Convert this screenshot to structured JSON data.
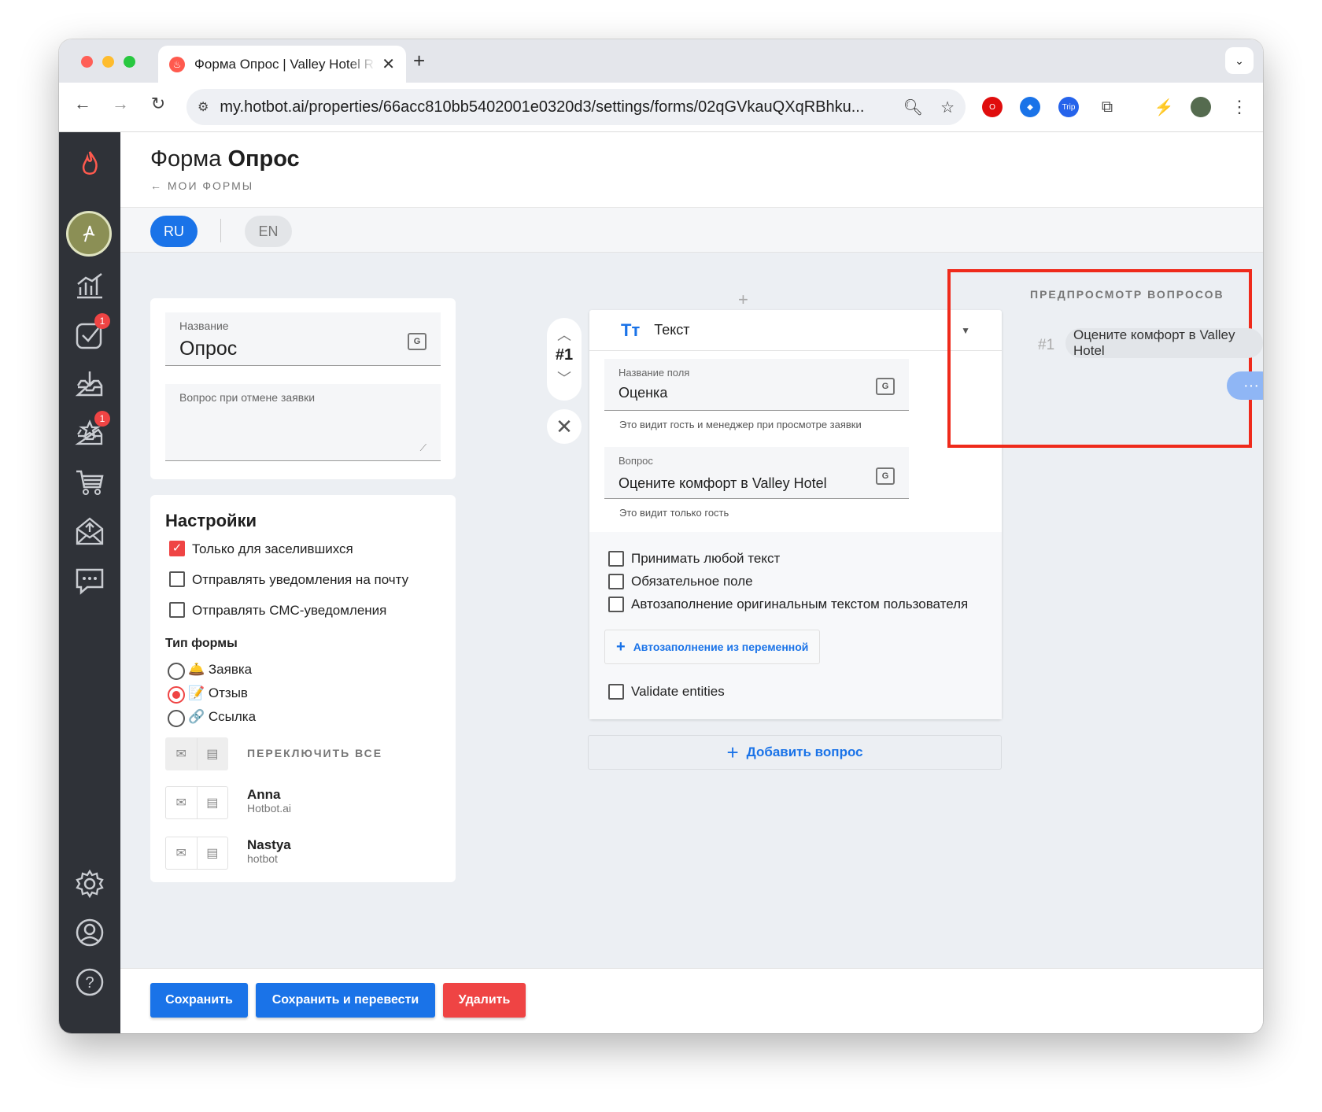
{
  "browser": {
    "tab_title": "Форма Опрос | Valley Hotel R",
    "url": "my.hotbot.ai/properties/66acc810bb5402001e0320d3/settings/forms/02qGVkauQXqRBhku..."
  },
  "sidebar": {
    "badges": {
      "tasks": "1",
      "reviews": "1"
    }
  },
  "header": {
    "title_prefix": "Форма ",
    "title_bold": "Опрос",
    "back_link": "← МОИ ФОРМЫ"
  },
  "langs": [
    "RU",
    "EN"
  ],
  "form": {
    "name_label": "Название",
    "name_value": "Опрос",
    "cancel_question_label": "Вопрос при отмене заявки",
    "cancel_question_value": ""
  },
  "settings": {
    "title": "Настройки",
    "checkboxes": [
      {
        "label": "Только для заселившихся",
        "checked": true
      },
      {
        "label": "Отправлять уведомления на почту",
        "checked": false
      },
      {
        "label": "Отправлять СМС-уведомления",
        "checked": false
      }
    ],
    "form_type_title": "Тип формы",
    "form_types": [
      {
        "label": "🛎️ Заявка",
        "selected": false
      },
      {
        "label": "📝 Отзыв",
        "selected": true
      },
      {
        "label": "🔗 Ссылка",
        "selected": false
      }
    ],
    "toggle_all": "ПЕРЕКЛЮЧИТЬ ВСЕ",
    "people": [
      {
        "name": "Anna",
        "org": "Hotbot.ai"
      },
      {
        "name": "Nastya",
        "org": "hotbot"
      }
    ]
  },
  "question": {
    "number": "#1",
    "type": "Текст",
    "field_name_label": "Название поля",
    "field_name_value": "Оценка",
    "field_name_helper": "Это видит гость и менеджер при просмотре заявки",
    "question_label": "Вопрос",
    "question_value": "Оцените комфорт в Valley Hotel",
    "question_helper": "Это видит только гость",
    "options": [
      {
        "label": "Принимать любой текст",
        "checked": false
      },
      {
        "label": "Обязательное поле",
        "checked": false
      },
      {
        "label": "Автозаполнение оригинальным текстом пользователя",
        "checked": false
      }
    ],
    "autofill_button": "Автозаполнение из переменной",
    "validate_label": "Validate entities",
    "add_question": "Добавить вопрос"
  },
  "preview": {
    "title": "ПРЕДПРОСМОТР ВОПРОСОВ",
    "number": "#1",
    "question": "Оцените комфорт в Valley Hotel",
    "typing": "···"
  },
  "footer": {
    "save": "Сохранить",
    "save_translate": "Сохранить и перевести",
    "delete": "Удалить"
  },
  "colors": {
    "accent": "#1a73e8",
    "danger": "#ef4444",
    "sidebar": "#2f3238",
    "highlight": "#ef2a1b"
  }
}
